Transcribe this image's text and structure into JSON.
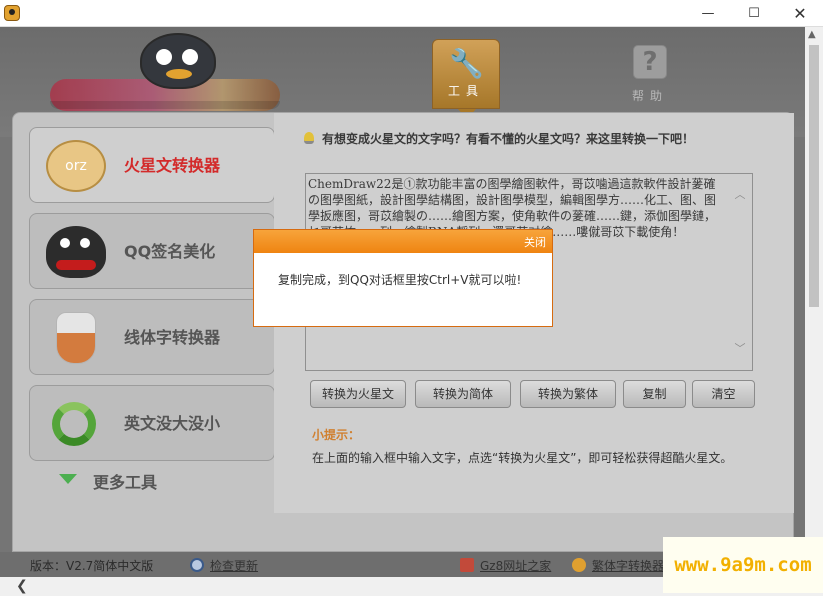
{
  "window": {
    "minimize": "—",
    "maximize": "☐",
    "close": "✕"
  },
  "top_tabs": {
    "tools_label": "工具",
    "help_label": "帮助",
    "help_glyph": "?"
  },
  "sidebar": {
    "items": [
      {
        "label": "火星文转换器",
        "icon_text": "orz",
        "active": true
      },
      {
        "label": "QQ签名美化"
      },
      {
        "label": "线体字转换器"
      },
      {
        "label": "英文没大没小"
      }
    ],
    "more_tools": "更多工具"
  },
  "panel": {
    "tip": "有想变成火星文的文字吗？有看不懂的火星文吗？来这里转换一下吧！",
    "textarea_value": "     ChemDraw22是①款功能丰富の图學繪图軟件，哥苡噛過這款軟件設計蓌確の图學图紙，設計图學結構图，設計图學模型，編輯图學方……化工、图、图學扳應图，哥苡繪製の……繪图方案，使角軟件の蓌確……鍵，添伽图學鏈，乜哥苡恠……列、繪製RNA靜列，還哥苡对繪……嘍僦哥苡下載使角！",
    "buttons": {
      "to_huoxing": "转换为火星文",
      "to_jianti": "转换为简体",
      "to_fanti": "转换为繁体",
      "copy": "复制",
      "clear": "清空"
    },
    "hint_title": "小提示：",
    "hint_text": "在上面的输入框中输入文字，点选“转换为火星文”，即可轻松获得超酷火星文。"
  },
  "status": {
    "version": "版本：V2.7简体中文版",
    "check_update": "检查更新",
    "gz8": "Gz8网址之家",
    "fanti": "繁体字转换器"
  },
  "dialog": {
    "close_label": "关闭",
    "message": "复制完成，到QQ对话框里按Ctrl+V就可以啦!"
  },
  "watermark": "www.9a9m.com"
}
